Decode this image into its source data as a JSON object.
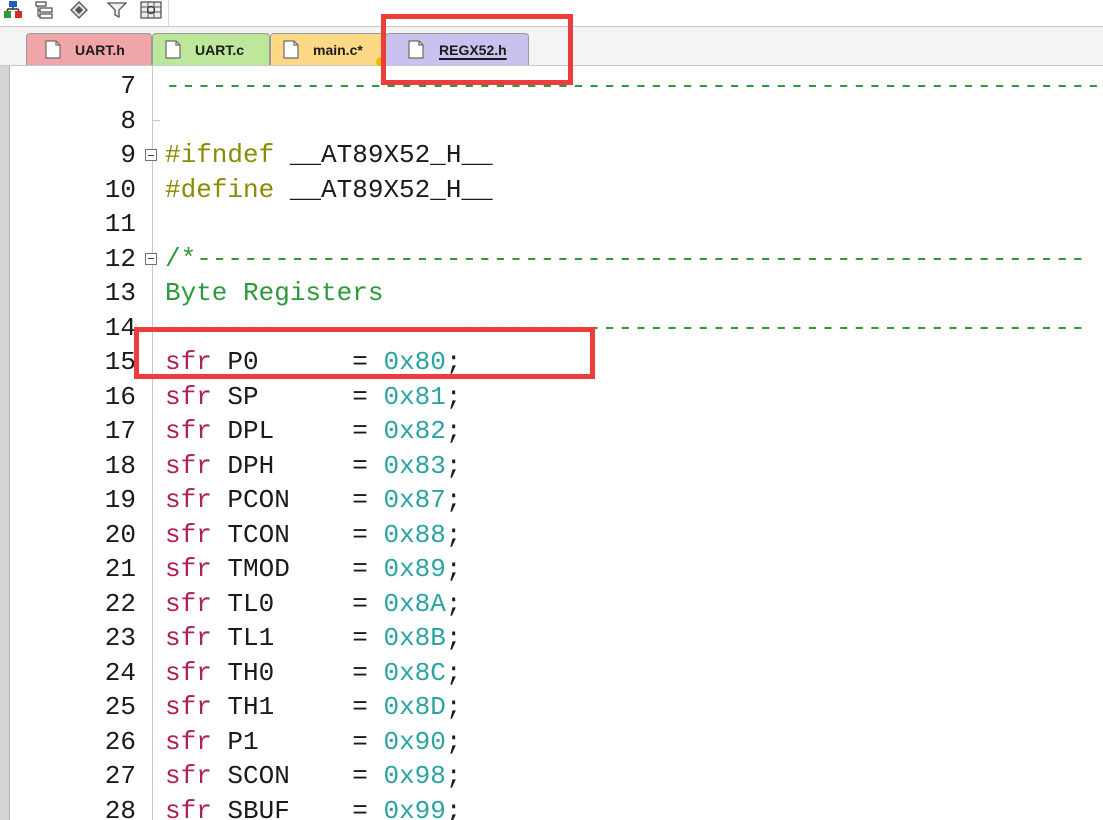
{
  "toolbar": {
    "icons": [
      "tree-icon",
      "list-icon",
      "diamond-icon",
      "filter-icon",
      "grid-icon"
    ]
  },
  "tabs": [
    {
      "label": "UART.h",
      "color": "#f0a5a8",
      "active": false
    },
    {
      "label": "UART.c",
      "color": "#bde79a",
      "active": false
    },
    {
      "label": "main.c*",
      "color": "#fdd985",
      "active": false
    },
    {
      "label": "REGX52.h",
      "color": "#c9c2ef",
      "active": true
    }
  ],
  "editor": {
    "lines": [
      {
        "n": "7",
        "segments": [
          {
            "t": "------------------------------------------------------------",
            "c": "c-comment"
          }
        ]
      },
      {
        "n": "8",
        "segments": []
      },
      {
        "n": "9",
        "segments": [
          {
            "t": "#ifndef ",
            "c": "c-pre"
          },
          {
            "t": "__AT89X52_H__",
            "c": "c-macro"
          }
        ]
      },
      {
        "n": "10",
        "segments": [
          {
            "t": "#define ",
            "c": "c-pre"
          },
          {
            "t": "__AT89X52_H__",
            "c": "c-macro"
          }
        ]
      },
      {
        "n": "11",
        "segments": []
      },
      {
        "n": "12",
        "segments": [
          {
            "t": "/*---------------------------------------------------------",
            "c": "c-comment"
          }
        ]
      },
      {
        "n": "13",
        "segments": [
          {
            "t": "Byte Registers",
            "c": "c-comment"
          }
        ]
      },
      {
        "n": "14",
        "segments": [
          {
            "t": "-----------------------------------------------------------",
            "c": "c-comment"
          }
        ]
      },
      {
        "n": "15",
        "segments": [
          {
            "t": "sfr ",
            "c": "c-kw"
          },
          {
            "t": "P0      ",
            "c": "c-ident"
          },
          {
            "t": "= ",
            "c": "c-op"
          },
          {
            "t": "0x80",
            "c": "c-num"
          },
          {
            "t": ";",
            "c": "c-op"
          }
        ]
      },
      {
        "n": "16",
        "segments": [
          {
            "t": "sfr ",
            "c": "c-kw"
          },
          {
            "t": "SP      ",
            "c": "c-ident"
          },
          {
            "t": "= ",
            "c": "c-op"
          },
          {
            "t": "0x81",
            "c": "c-num"
          },
          {
            "t": ";",
            "c": "c-op"
          }
        ]
      },
      {
        "n": "17",
        "segments": [
          {
            "t": "sfr ",
            "c": "c-kw"
          },
          {
            "t": "DPL     ",
            "c": "c-ident"
          },
          {
            "t": "= ",
            "c": "c-op"
          },
          {
            "t": "0x82",
            "c": "c-num"
          },
          {
            "t": ";",
            "c": "c-op"
          }
        ]
      },
      {
        "n": "18",
        "segments": [
          {
            "t": "sfr ",
            "c": "c-kw"
          },
          {
            "t": "DPH     ",
            "c": "c-ident"
          },
          {
            "t": "= ",
            "c": "c-op"
          },
          {
            "t": "0x83",
            "c": "c-num"
          },
          {
            "t": ";",
            "c": "c-op"
          }
        ]
      },
      {
        "n": "19",
        "segments": [
          {
            "t": "sfr ",
            "c": "c-kw"
          },
          {
            "t": "PCON    ",
            "c": "c-ident"
          },
          {
            "t": "= ",
            "c": "c-op"
          },
          {
            "t": "0x87",
            "c": "c-num"
          },
          {
            "t": ";",
            "c": "c-op"
          }
        ]
      },
      {
        "n": "20",
        "segments": [
          {
            "t": "sfr ",
            "c": "c-kw"
          },
          {
            "t": "TCON    ",
            "c": "c-ident"
          },
          {
            "t": "= ",
            "c": "c-op"
          },
          {
            "t": "0x88",
            "c": "c-num"
          },
          {
            "t": ";",
            "c": "c-op"
          }
        ]
      },
      {
        "n": "21",
        "segments": [
          {
            "t": "sfr ",
            "c": "c-kw"
          },
          {
            "t": "TMOD    ",
            "c": "c-ident"
          },
          {
            "t": "= ",
            "c": "c-op"
          },
          {
            "t": "0x89",
            "c": "c-num"
          },
          {
            "t": ";",
            "c": "c-op"
          }
        ]
      },
      {
        "n": "22",
        "segments": [
          {
            "t": "sfr ",
            "c": "c-kw"
          },
          {
            "t": "TL0     ",
            "c": "c-ident"
          },
          {
            "t": "= ",
            "c": "c-op"
          },
          {
            "t": "0x8A",
            "c": "c-num"
          },
          {
            "t": ";",
            "c": "c-op"
          }
        ]
      },
      {
        "n": "23",
        "segments": [
          {
            "t": "sfr ",
            "c": "c-kw"
          },
          {
            "t": "TL1     ",
            "c": "c-ident"
          },
          {
            "t": "= ",
            "c": "c-op"
          },
          {
            "t": "0x8B",
            "c": "c-num"
          },
          {
            "t": ";",
            "c": "c-op"
          }
        ]
      },
      {
        "n": "24",
        "segments": [
          {
            "t": "sfr ",
            "c": "c-kw"
          },
          {
            "t": "TH0     ",
            "c": "c-ident"
          },
          {
            "t": "= ",
            "c": "c-op"
          },
          {
            "t": "0x8C",
            "c": "c-num"
          },
          {
            "t": ";",
            "c": "c-op"
          }
        ]
      },
      {
        "n": "25",
        "segments": [
          {
            "t": "sfr ",
            "c": "c-kw"
          },
          {
            "t": "TH1     ",
            "c": "c-ident"
          },
          {
            "t": "= ",
            "c": "c-op"
          },
          {
            "t": "0x8D",
            "c": "c-num"
          },
          {
            "t": ";",
            "c": "c-op"
          }
        ]
      },
      {
        "n": "26",
        "segments": [
          {
            "t": "sfr ",
            "c": "c-kw"
          },
          {
            "t": "P1      ",
            "c": "c-ident"
          },
          {
            "t": "= ",
            "c": "c-op"
          },
          {
            "t": "0x90",
            "c": "c-num"
          },
          {
            "t": ";",
            "c": "c-op"
          }
        ]
      },
      {
        "n": "27",
        "segments": [
          {
            "t": "sfr ",
            "c": "c-kw"
          },
          {
            "t": "SCON    ",
            "c": "c-ident"
          },
          {
            "t": "= ",
            "c": "c-op"
          },
          {
            "t": "0x98",
            "c": "c-num"
          },
          {
            "t": ";",
            "c": "c-op"
          }
        ]
      },
      {
        "n": "28",
        "segments": [
          {
            "t": "sfr ",
            "c": "c-kw"
          },
          {
            "t": "SBUF    ",
            "c": "c-ident"
          },
          {
            "t": "= ",
            "c": "c-op"
          },
          {
            "t": "0x99",
            "c": "c-num"
          },
          {
            "t": ";",
            "c": "c-op"
          }
        ]
      }
    ]
  },
  "colors": {
    "highlight": "#ee3c3c",
    "comment": "#2b9a3a",
    "preprocessor": "#8b8b00",
    "keyword": "#b0205a",
    "number": "#2ba3a3"
  }
}
